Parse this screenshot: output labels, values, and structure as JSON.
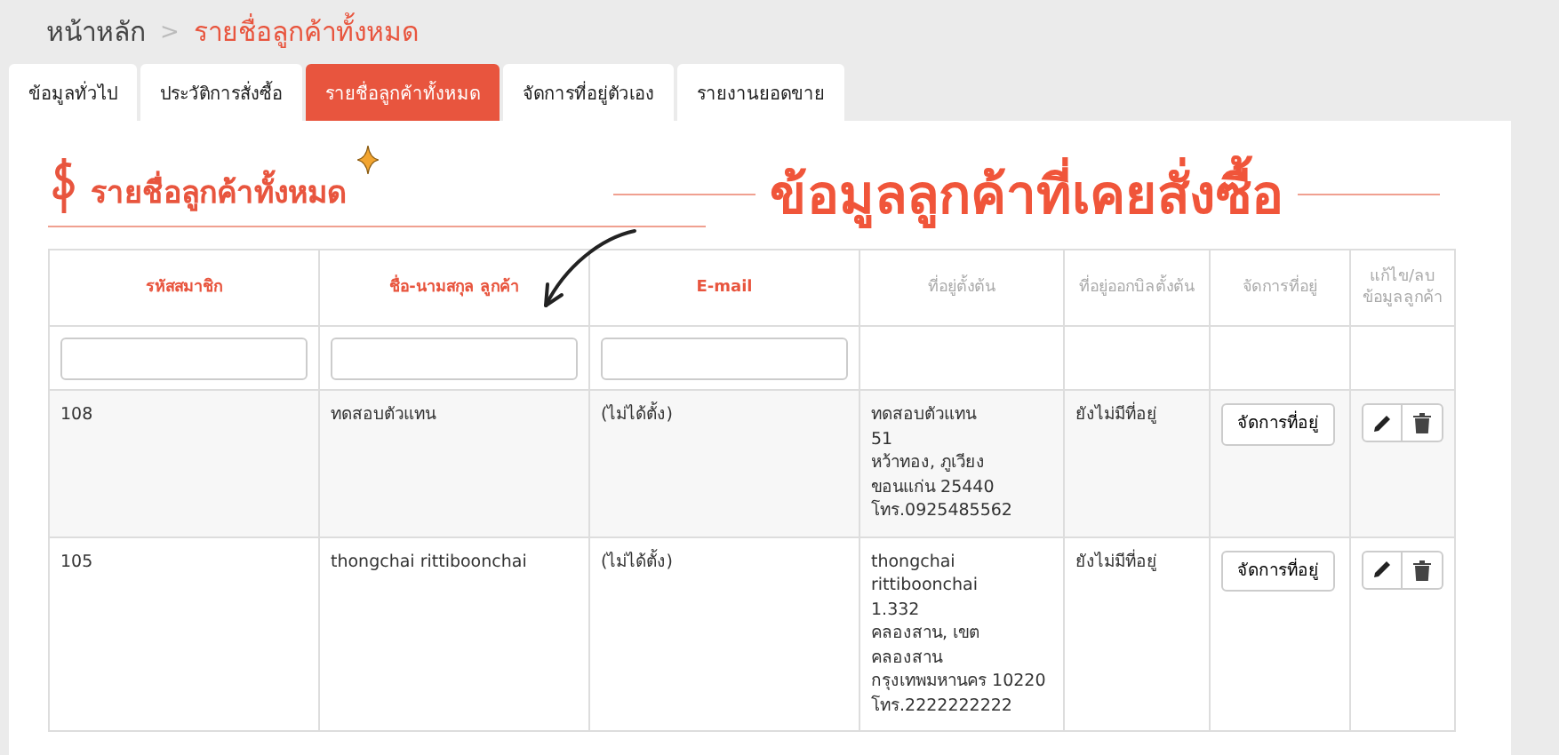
{
  "breadcrumb": {
    "items": [
      "หน้าหลัก",
      "รายชื่อลูกค้าทั้งหมด"
    ],
    "separator": ">"
  },
  "tabs": [
    {
      "label": "ข้อมูลทั่วไป",
      "selected": false
    },
    {
      "label": "ประวัติการสั่งซื้อ",
      "selected": false
    },
    {
      "label": "รายชื่อลูกค้าทั้งหมด",
      "selected": true
    },
    {
      "label": "จัดการที่อยู่ตัวเอง",
      "selected": false
    },
    {
      "label": "รายงานยอดขาย",
      "selected": false
    }
  ],
  "section_title": "รายชื่อลูกค้าทั้งหมด",
  "annotation": "ข้อมูลลูกค้าที่เคยสั่งซื้อ",
  "table": {
    "columns": [
      {
        "label": "รหัสสมาชิก",
        "sortable": true,
        "filterable": true
      },
      {
        "label": "ชื่อ-นามสกุล ลูกค้า",
        "sortable": true,
        "filterable": true
      },
      {
        "label": "E-mail",
        "sortable": true,
        "filterable": true
      },
      {
        "label": "ที่อยู่ตั้งต้น",
        "sortable": false,
        "filterable": false
      },
      {
        "label": "ที่อยู่ออกบิลตั้งต้น",
        "sortable": false,
        "filterable": false
      },
      {
        "label": "จัดการที่อยู่",
        "sortable": false,
        "filterable": false
      },
      {
        "label": "แก้ไข/ลบข้อมูลลูกค้า",
        "sortable": false,
        "filterable": false
      }
    ],
    "rows": [
      {
        "id": "108",
        "name": "ทดสอบตัวแทน",
        "email": "(ไม่ได้ตั้ง)",
        "address": "ทดสอบตัวแทน\n51\nหว้าทอง, ภูเวียง\nขอนแก่น 25440\nโทร.0925485562",
        "billing_address": "ยังไม่มีที่อยู่",
        "manage_button": "จัดการที่อยู่"
      },
      {
        "id": "105",
        "name": "thongchai rittiboonchai",
        "email": "(ไม่ได้ตั้ง)",
        "address": "thongchai\nrittiboonchai\n1.332\nคลองสาน, เขต\nคลองสาน\nกรุงเทพมหานคร 10220\nโทร.2222222222",
        "billing_address": "ยังไม่มีที่อยู่",
        "manage_button": "จัดการที่อยู่"
      }
    ]
  }
}
